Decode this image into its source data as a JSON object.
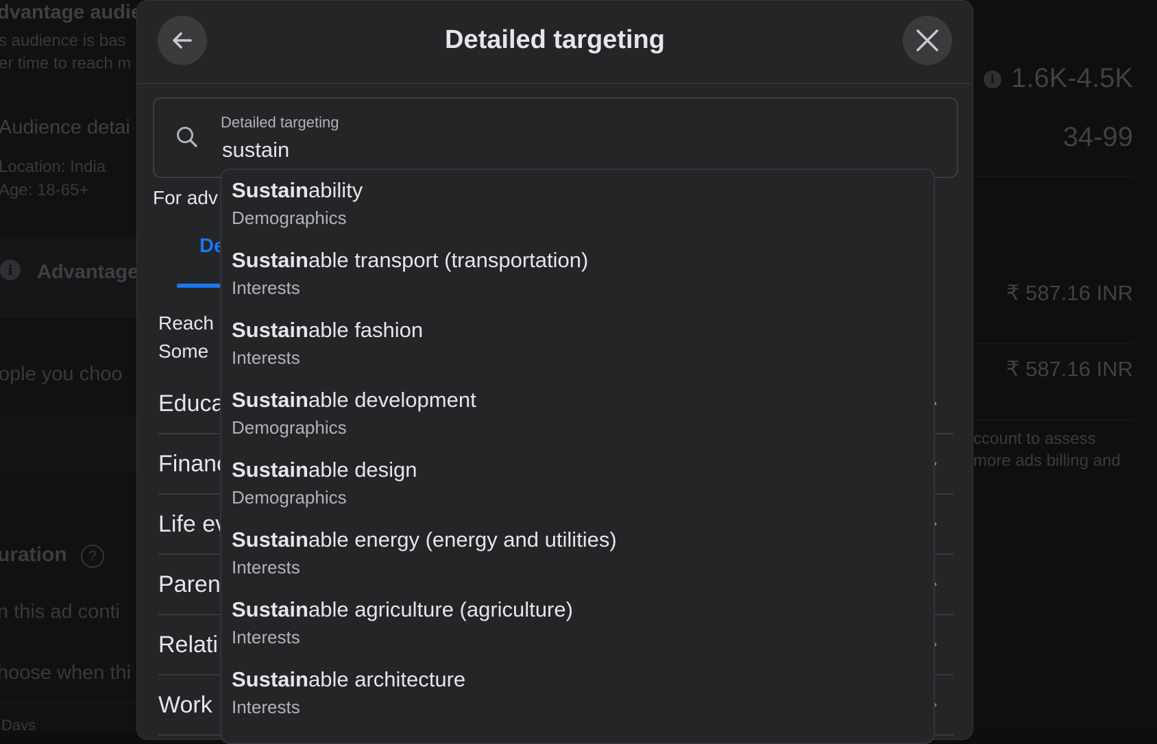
{
  "background": {
    "left": {
      "audience_title": "dvantage audie",
      "audience_desc_1": "s audience is bas",
      "audience_desc_2": "er time to reach m",
      "details_title": "Audience detai",
      "location": "Location: India",
      "age": "Age: 18-65+",
      "advantage_label": "Advantage",
      "people_text": "ople you choo",
      "duration_title": "uration",
      "duration_help": "?",
      "run_text": "n this ad conti",
      "choose_text": "hoose when thi",
      "days_label": "Days"
    },
    "right": {
      "reach_estimate": "1.6K-4.5K",
      "secondary_estimate": "34-99",
      "budget_1": "₹ 587.16 INR",
      "budget_2": "₹ 587.16 INR",
      "note_1": "ccount to assess",
      "note_2": "more ads billing and"
    }
  },
  "modal": {
    "title": "Detailed targeting",
    "back_icon": "arrow-left-icon",
    "close_icon": "close-icon",
    "search": {
      "label": "Detailed targeting",
      "value": "sustain",
      "icon": "search-icon"
    },
    "advice_text": "For adv",
    "tab_label": "De",
    "reach_line_1": "Reach",
    "reach_line_2": "Some",
    "categories": [
      {
        "label": "Educa"
      },
      {
        "label": "Financ"
      },
      {
        "label": "Life ev"
      },
      {
        "label": "Paren"
      },
      {
        "label": "Relati"
      },
      {
        "label": "Work"
      }
    ]
  },
  "dropdown": {
    "query_match": "Sustain",
    "items": [
      {
        "match": "Sustain",
        "rest": "ability",
        "type": "Demographics"
      },
      {
        "match": "Sustain",
        "rest": "able transport (transportation)",
        "type": "Interests"
      },
      {
        "match": "Sustain",
        "rest": "able fashion",
        "type": "Interests"
      },
      {
        "match": "Sustain",
        "rest": "able development",
        "type": "Demographics"
      },
      {
        "match": "Sustain",
        "rest": "able design",
        "type": "Demographics"
      },
      {
        "match": "Sustain",
        "rest": "able energy (energy and utilities)",
        "type": "Interests"
      },
      {
        "match": "Sustain",
        "rest": "able agriculture (agriculture)",
        "type": "Interests"
      },
      {
        "match": "Sustain",
        "rest": "able architecture",
        "type": "Interests"
      }
    ]
  },
  "colors": {
    "accent": "#1877f2",
    "modal_bg": "#242527",
    "page_bg": "#0e0e0f",
    "text_primary": "#e4e6eb",
    "text_secondary": "#b0b3b8"
  }
}
